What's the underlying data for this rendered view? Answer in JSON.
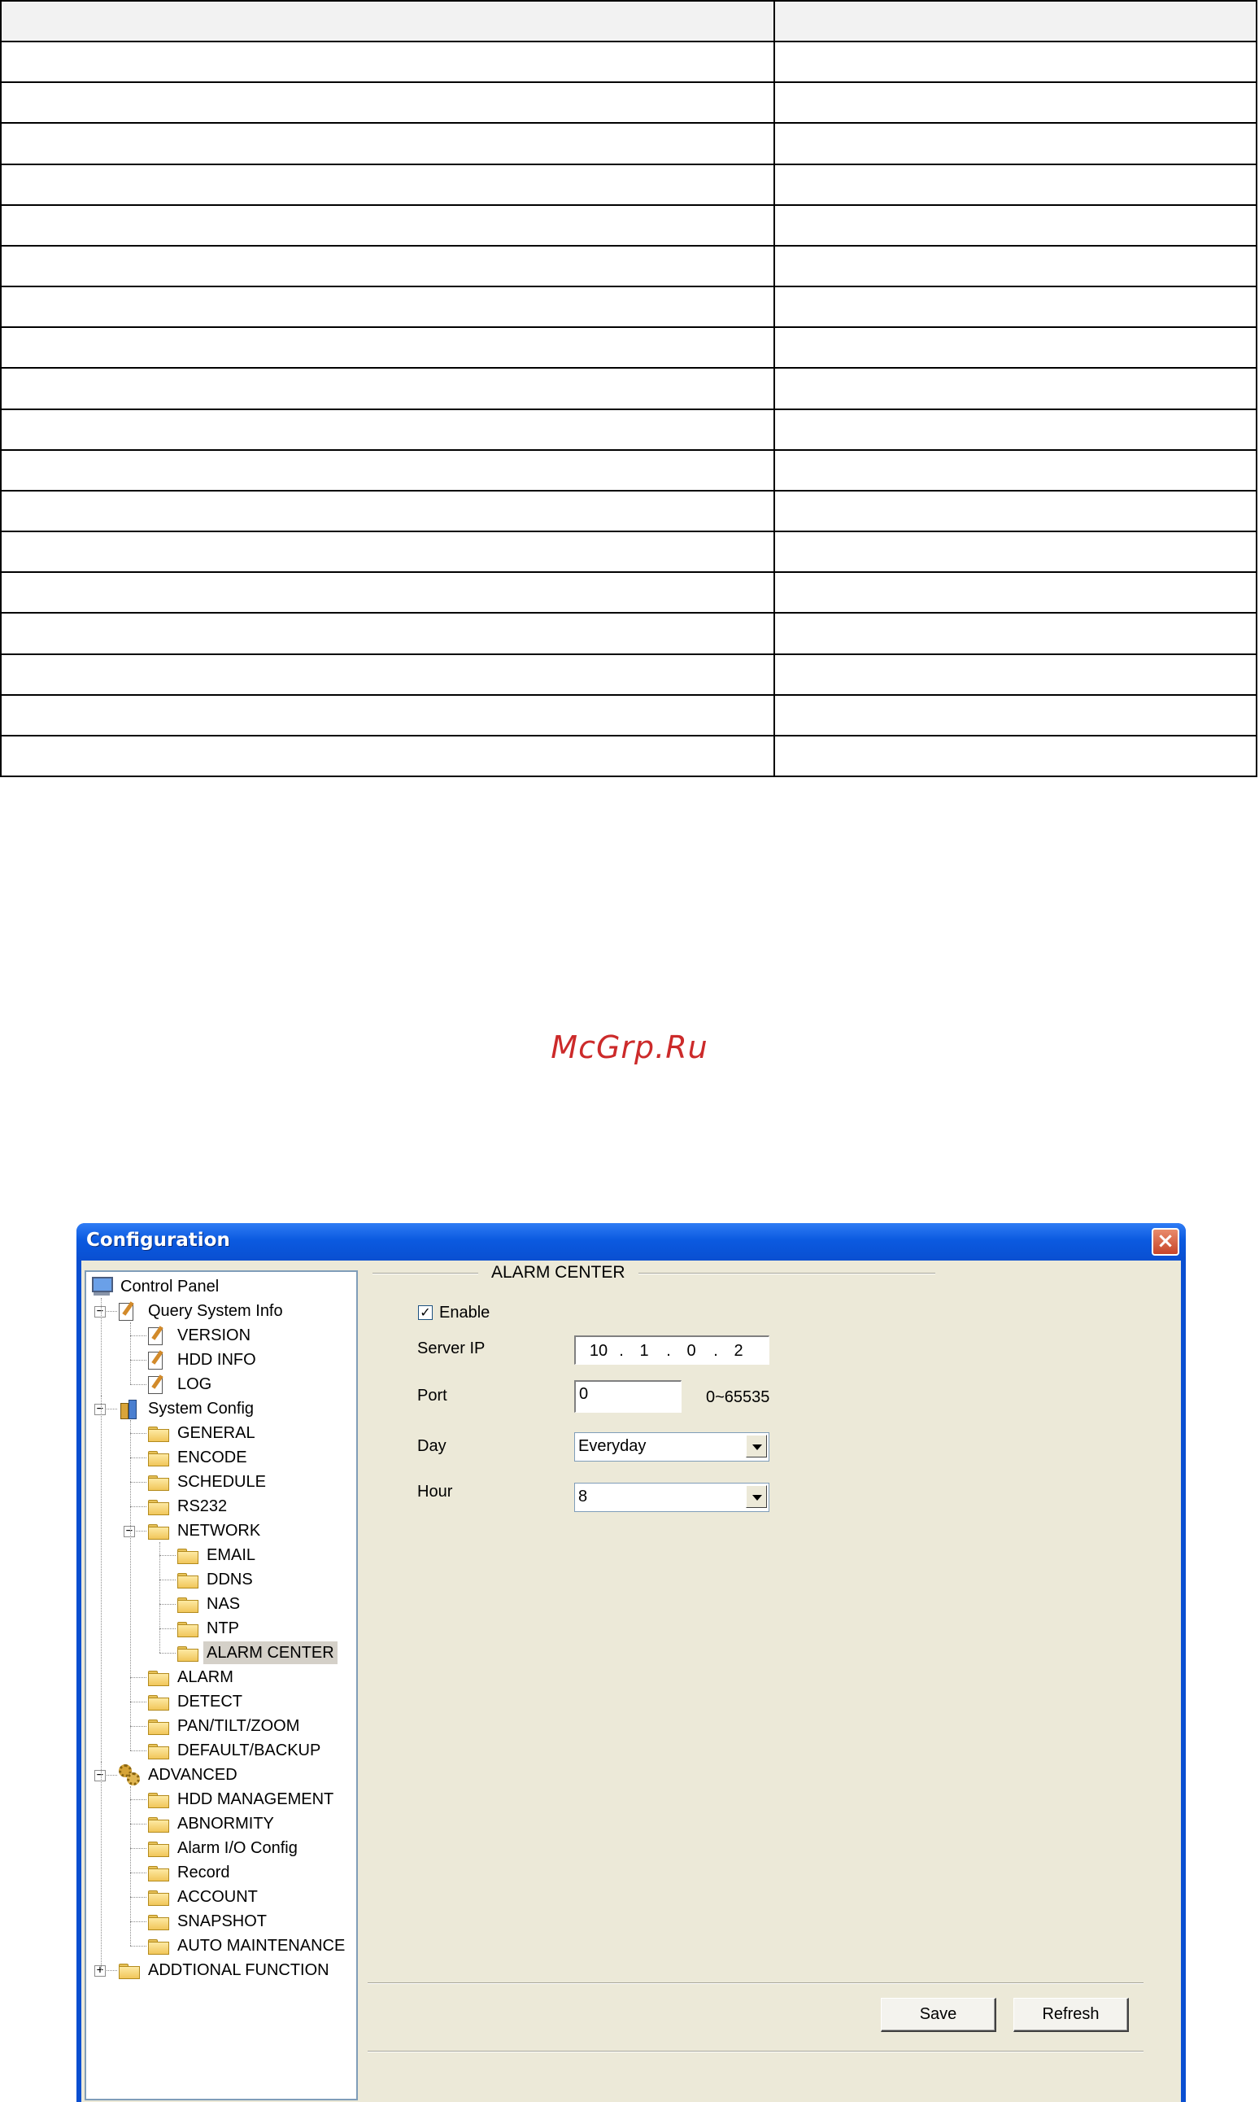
{
  "table": {
    "rows": 19,
    "columns": 2
  },
  "watermark": "McGrp.Ru",
  "window": {
    "title": "Configuration",
    "close_label": "×"
  },
  "tree": {
    "nodes": [
      {
        "label": "Control Panel",
        "icon": "monitor-icon"
      },
      {
        "label": "Query System Info",
        "icon": "edit-doc-icon",
        "expander": "−"
      },
      {
        "label": "VERSION",
        "icon": "edit-doc-icon"
      },
      {
        "label": "HDD INFO",
        "icon": "edit-doc-icon"
      },
      {
        "label": "LOG",
        "icon": "edit-doc-icon"
      },
      {
        "label": "System Config",
        "icon": "tools-icon",
        "expander": "−"
      },
      {
        "label": "GENERAL",
        "icon": "folder-icon"
      },
      {
        "label": "ENCODE",
        "icon": "folder-icon"
      },
      {
        "label": "SCHEDULE",
        "icon": "folder-icon"
      },
      {
        "label": "RS232",
        "icon": "folder-icon"
      },
      {
        "label": "NETWORK",
        "icon": "folder-icon",
        "expander": "−"
      },
      {
        "label": "EMAIL",
        "icon": "folder-icon"
      },
      {
        "label": "DDNS",
        "icon": "folder-icon"
      },
      {
        "label": "NAS",
        "icon": "folder-icon"
      },
      {
        "label": "NTP",
        "icon": "folder-icon"
      },
      {
        "label": "ALARM CENTER",
        "icon": "open-folder-icon",
        "selected": true
      },
      {
        "label": "ALARM",
        "icon": "folder-icon"
      },
      {
        "label": "DETECT",
        "icon": "folder-icon"
      },
      {
        "label": "PAN/TILT/ZOOM",
        "icon": "folder-icon"
      },
      {
        "label": "DEFAULT/BACKUP",
        "icon": "folder-icon"
      },
      {
        "label": "ADVANCED",
        "icon": "gear-icon",
        "expander": "−"
      },
      {
        "label": "HDD MANAGEMENT",
        "icon": "folder-icon"
      },
      {
        "label": "ABNORMITY",
        "icon": "folder-icon"
      },
      {
        "label": "Alarm I/O Config",
        "icon": "folder-icon"
      },
      {
        "label": "Record",
        "icon": "folder-icon"
      },
      {
        "label": "ACCOUNT",
        "icon": "folder-icon"
      },
      {
        "label": "SNAPSHOT",
        "icon": "folder-icon"
      },
      {
        "label": "AUTO MAINTENANCE",
        "icon": "folder-icon"
      },
      {
        "label": "ADDTIONAL FUNCTION",
        "icon": "folder-icon",
        "expander": "+"
      }
    ]
  },
  "panel": {
    "title": "ALARM CENTER",
    "enable": {
      "label": "Enable",
      "checked": true,
      "mark": "✓"
    },
    "server_ip": {
      "label": "Server IP",
      "octets": [
        "10",
        "1",
        "0",
        "2"
      ],
      "dot": "."
    },
    "port": {
      "label": "Port",
      "value": "0",
      "range": "0~65535"
    },
    "day": {
      "label": "Day",
      "value": "Everyday"
    },
    "hour": {
      "label": "Hour",
      "value": "8"
    },
    "save_label": "Save",
    "refresh_label": "Refresh"
  },
  "colors": {
    "titlebar": "#0a4fd1",
    "dialog_bg": "#ece9d8",
    "watermark": "#cc2a2a"
  }
}
